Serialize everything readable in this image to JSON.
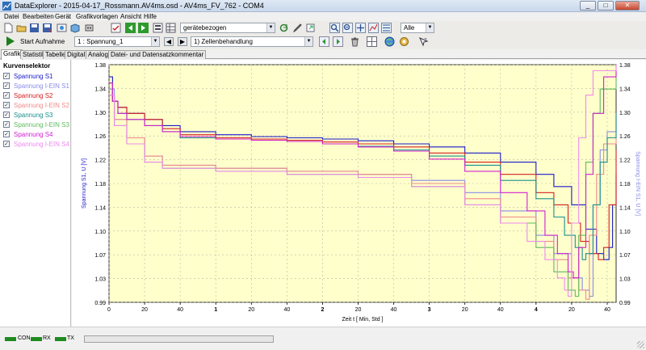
{
  "window": {
    "title": "DataExplorer  -  2015-04-17_Rossmann.AV4ms.osd  -  AV4ms_FV_762  -  COM4",
    "minimize": "_",
    "maximize": "□",
    "close": "✕"
  },
  "menu": [
    "Datei",
    "Bearbeiten",
    "Gerät",
    "Grafikvorlagen",
    "Ansicht",
    "Hilfe"
  ],
  "toolbar1": {
    "combo_mode": "gerätebezogen",
    "combo_filter": "Alle"
  },
  "toolbar2": {
    "start_label": "Start Aufnahme",
    "combo_channel": "1 : Spannung_1",
    "combo_record": "1) Zellenbehandlung"
  },
  "tabs": [
    {
      "label": "Grafik",
      "active": true
    },
    {
      "label": "Statistik",
      "active": false
    },
    {
      "label": "Tabelle",
      "active": false
    },
    {
      "label": "Digital",
      "active": false
    },
    {
      "label": "Analog",
      "active": false
    },
    {
      "label": "Datei- und Datensatzkommentar",
      "active": false
    }
  ],
  "selector": {
    "header": "Kurvenselektor",
    "items": [
      {
        "label": "Spannung S1",
        "color": "#1a1acc",
        "checked": true
      },
      {
        "label": "Spannung I-EIN S1",
        "color": "#8a8ae8",
        "checked": true
      },
      {
        "label": "Spannung S2",
        "color": "#d42020",
        "checked": true
      },
      {
        "label": "Spannung I-EIN S2",
        "color": "#ee8a8a",
        "checked": true
      },
      {
        "label": "Spannung S3",
        "color": "#1a8f8f",
        "checked": true
      },
      {
        "label": "Spannung I-EIN S3",
        "color": "#5fba5f",
        "checked": true
      },
      {
        "label": "Spannung S4",
        "color": "#d020d0",
        "checked": true
      },
      {
        "label": "Spannung I-EIN S4",
        "color": "#ee8aee",
        "checked": true
      }
    ]
  },
  "status": {
    "leds": [
      "CON",
      "RX",
      "TX"
    ]
  },
  "chart_data": {
    "type": "line",
    "xlabel": "Zeit  t  [ Min, Std ]",
    "ylabel_left": "Spannung S1, U  [V]",
    "ylabel_right": "Spannung I-EIN S1,  U  [V]",
    "xlim": [
      0,
      285
    ],
    "ylim": [
      0.99,
      1.38
    ],
    "grid": true,
    "x_ticks": [
      {
        "at": 0,
        "label": "0"
      },
      {
        "at": 20,
        "label": "20"
      },
      {
        "at": 40,
        "label": "40"
      },
      {
        "at": 60,
        "label": "1"
      },
      {
        "at": 80,
        "label": "20"
      },
      {
        "at": 100,
        "label": "40"
      },
      {
        "at": 120,
        "label": "2"
      },
      {
        "at": 140,
        "label": "20"
      },
      {
        "at": 160,
        "label": "40"
      },
      {
        "at": 180,
        "label": "3"
      },
      {
        "at": 200,
        "label": "20"
      },
      {
        "at": 220,
        "label": "40"
      },
      {
        "at": 240,
        "label": "4"
      },
      {
        "at": 260,
        "label": "20"
      },
      {
        "at": 280,
        "label": "40"
      }
    ],
    "y_ticks": [
      "0.99",
      "1.03",
      "1.07",
      "1.10",
      "1.14",
      "1.18",
      "1.22",
      "1.26",
      "1.30",
      "1.34",
      "1.38"
    ],
    "series": [
      {
        "name": "Spannung S1",
        "color": "#1a1acc",
        "x": [
          0,
          2,
          5,
          10,
          20,
          30,
          40,
          60,
          80,
          100,
          120,
          140,
          160,
          180,
          200,
          220,
          240,
          250,
          260,
          268,
          274,
          278,
          281,
          283,
          285
        ],
        "y": [
          1.36,
          1.32,
          1.31,
          1.3,
          1.29,
          1.28,
          1.27,
          1.265,
          1.262,
          1.26,
          1.258,
          1.255,
          1.25,
          1.245,
          1.235,
          1.22,
          1.2,
          1.18,
          1.15,
          1.11,
          1.07,
          1.06,
          1.08,
          1.15,
          1.2
        ]
      },
      {
        "name": "Spannung I-EIN S1",
        "color": "#8a8ae8",
        "x": [
          0,
          3,
          10,
          20,
          30,
          60,
          100,
          140,
          170,
          200,
          220,
          240,
          250,
          260,
          266,
          270,
          272,
          276,
          280,
          285
        ],
        "y": [
          1.34,
          1.29,
          1.26,
          1.23,
          1.215,
          1.21,
          1.205,
          1.2,
          1.19,
          1.17,
          1.14,
          1.1,
          1.07,
          1.03,
          1.01,
          1.0,
          1.15,
          1.24,
          1.27,
          1.3
        ]
      },
      {
        "name": "Spannung S2",
        "color": "#d42020",
        "x": [
          0,
          2,
          5,
          10,
          20,
          30,
          40,
          60,
          80,
          100,
          120,
          140,
          160,
          180,
          200,
          220,
          240,
          250,
          258,
          265,
          270,
          275,
          278,
          281,
          285
        ],
        "y": [
          1.35,
          1.32,
          1.31,
          1.3,
          1.29,
          1.275,
          1.265,
          1.26,
          1.258,
          1.256,
          1.253,
          1.25,
          1.245,
          1.235,
          1.22,
          1.2,
          1.17,
          1.15,
          1.12,
          1.09,
          1.07,
          1.06,
          1.08,
          1.15,
          1.24
        ]
      },
      {
        "name": "Spannung I-EIN S2",
        "color": "#ee8a8a",
        "x": [
          0,
          3,
          10,
          20,
          30,
          60,
          100,
          140,
          170,
          200,
          220,
          240,
          250,
          258,
          264,
          268,
          270,
          274,
          278,
          285
        ],
        "y": [
          1.33,
          1.29,
          1.26,
          1.23,
          1.215,
          1.21,
          1.205,
          1.2,
          1.185,
          1.16,
          1.13,
          1.09,
          1.06,
          1.03,
          1.01,
          0.995,
          1.1,
          1.2,
          1.25,
          1.3
        ]
      },
      {
        "name": "Spannung S3",
        "color": "#1a8f8f",
        "x": [
          0,
          2,
          5,
          10,
          20,
          30,
          40,
          60,
          80,
          100,
          120,
          140,
          160,
          180,
          200,
          220,
          240,
          250,
          256,
          262,
          266,
          268,
          272,
          276,
          280,
          285
        ],
        "y": [
          1.35,
          1.32,
          1.3,
          1.29,
          1.28,
          1.27,
          1.26,
          1.258,
          1.256,
          1.254,
          1.25,
          1.246,
          1.24,
          1.23,
          1.215,
          1.19,
          1.16,
          1.13,
          1.1,
          1.08,
          1.06,
          1.07,
          1.15,
          1.22,
          1.26,
          1.3
        ]
      },
      {
        "name": "Spannung I-EIN S3",
        "color": "#5fba5f",
        "x": [
          0,
          3,
          10,
          20,
          30,
          60,
          100,
          140,
          170,
          200,
          220,
          240,
          250,
          258,
          262,
          264,
          268,
          272,
          276,
          285
        ],
        "y": [
          1.33,
          1.28,
          1.25,
          1.22,
          1.21,
          1.205,
          1.2,
          1.195,
          1.18,
          1.15,
          1.12,
          1.08,
          1.04,
          1.01,
          1.0,
          1.1,
          1.22,
          1.3,
          1.34,
          1.37
        ]
      },
      {
        "name": "Spannung S4",
        "color": "#d020d0",
        "x": [
          0,
          2,
          5,
          10,
          20,
          30,
          40,
          60,
          80,
          100,
          120,
          140,
          160,
          180,
          200,
          220,
          235,
          245,
          252,
          258,
          261,
          264,
          268,
          272,
          278,
          285
        ],
        "y": [
          1.35,
          1.32,
          1.3,
          1.29,
          1.28,
          1.27,
          1.262,
          1.258,
          1.256,
          1.254,
          1.25,
          1.245,
          1.238,
          1.225,
          1.205,
          1.17,
          1.14,
          1.1,
          1.07,
          1.04,
          1.03,
          1.08,
          1.2,
          1.3,
          1.36,
          1.38
        ]
      },
      {
        "name": "Spannung I-EIN S4",
        "color": "#ee8aee",
        "x": [
          0,
          3,
          10,
          20,
          30,
          60,
          100,
          140,
          170,
          200,
          220,
          235,
          245,
          252,
          256,
          258,
          260,
          264,
          268,
          272,
          285
        ],
        "y": [
          1.33,
          1.28,
          1.25,
          1.22,
          1.21,
          1.205,
          1.2,
          1.195,
          1.18,
          1.15,
          1.12,
          1.09,
          1.06,
          1.03,
          1.01,
          1.0,
          1.12,
          1.26,
          1.33,
          1.37,
          1.38
        ]
      }
    ]
  }
}
